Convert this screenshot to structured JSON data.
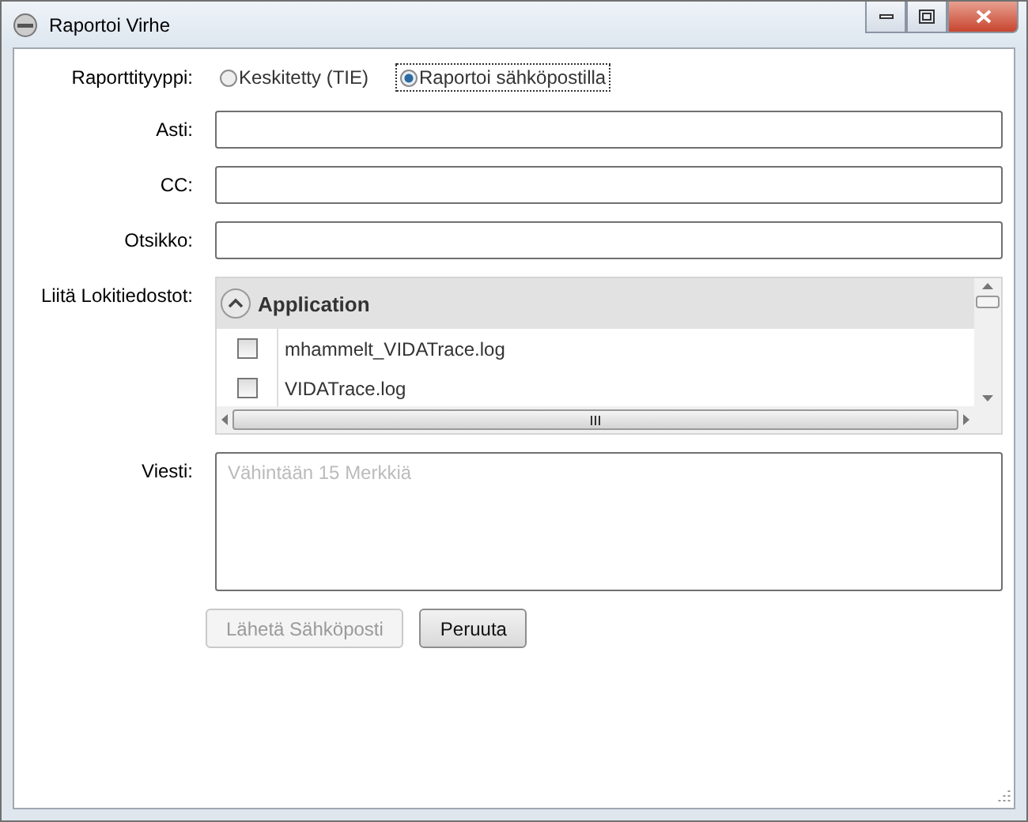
{
  "window": {
    "title": "Raportoi Virhe"
  },
  "report_type": {
    "label": "Raporttityyppi:",
    "options": [
      {
        "label": "Keskitetty (TIE)",
        "selected": false
      },
      {
        "label": "Raportoi sähköpostilla",
        "selected": true
      }
    ]
  },
  "fields": [
    {
      "label": "Asti:"
    },
    {
      "label": "CC:"
    },
    {
      "label": "Otsikko:"
    }
  ],
  "logs": {
    "label": "Liitä Lokitiedostot:",
    "group": {
      "label": "Application",
      "expanded": true
    },
    "files": [
      {
        "name": "mhammelt_VIDATrace.log",
        "checked": false
      },
      {
        "name": "VIDATrace.log",
        "checked": false
      }
    ]
  },
  "message": {
    "label": "Viesti:",
    "placeholder": "Vähintään 15 Merkkiä"
  },
  "buttons": [
    {
      "label": "Lähetä Sähköposti",
      "disabled": true
    },
    {
      "label": "Peruuta",
      "disabled": false
    }
  ]
}
